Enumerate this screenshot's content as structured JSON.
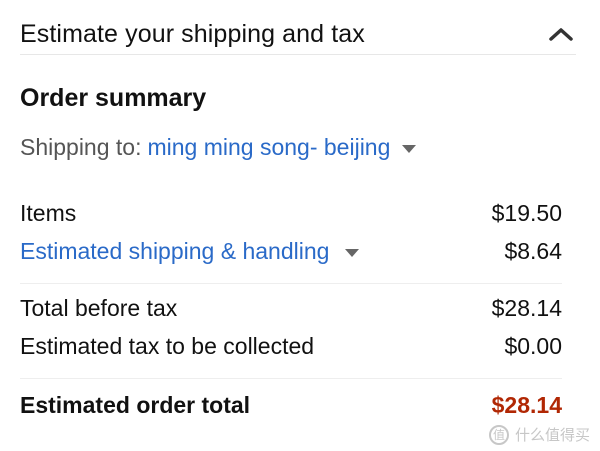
{
  "header": {
    "title": "Estimate your shipping and tax",
    "collapse_icon": "chevron-up-icon"
  },
  "summary": {
    "title": "Order summary",
    "shipping_label": "Shipping to:",
    "shipping_address": "ming ming song- beijing",
    "shipping_dropdown_icon": "caret-down-icon"
  },
  "lines": [
    {
      "label": "Items",
      "amount": "$19.50"
    },
    {
      "label": "Estimated shipping & handling",
      "amount": "$8.64"
    },
    {
      "label": "Total before tax",
      "amount": "$28.14"
    },
    {
      "label": "Estimated tax to be collected",
      "amount": "$0.00"
    }
  ],
  "total": {
    "label": "Estimated order total",
    "amount": "$28.14"
  },
  "watermark": {
    "text": "什么值得买",
    "logo_icon": "zhi-logo-icon"
  },
  "colors": {
    "link": "#2a6ac8",
    "total_amount": "#b12704",
    "text": "#111111",
    "muted": "#555555"
  }
}
